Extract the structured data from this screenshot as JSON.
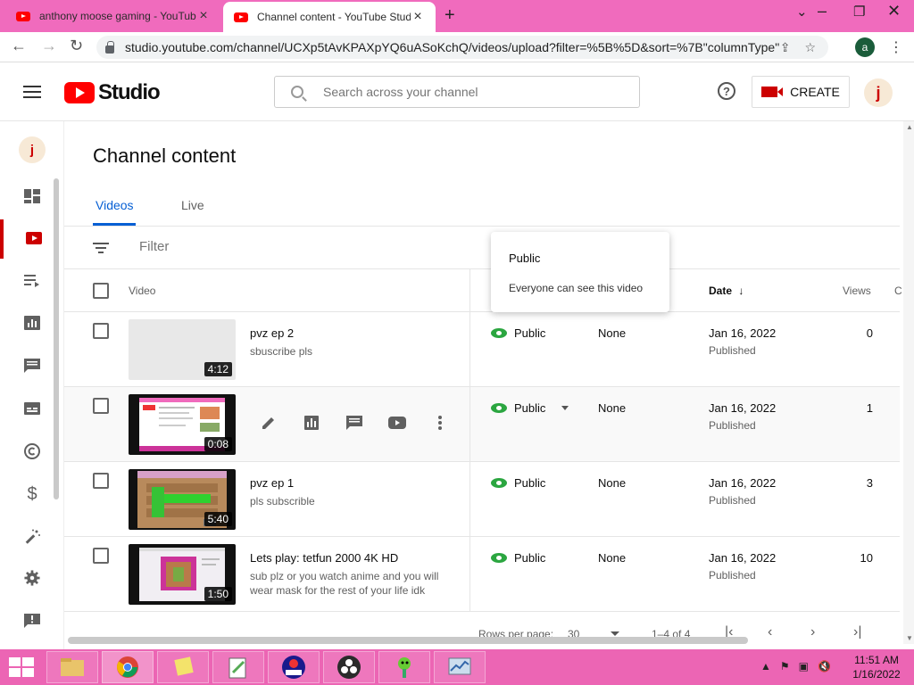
{
  "browser": {
    "tabs": [
      {
        "title": "anthony moose gaming - YouTube",
        "active": false
      },
      {
        "title": "Channel content - YouTube Studio",
        "active": true
      }
    ],
    "new_tab": "+",
    "url": "studio.youtube.com/channel/UCXp5tAvKPAXpYQ6uASoKchQ/videos/upload?filter=%5B%5D&sort=%7B\"columnType\"...",
    "profile_initial": "a"
  },
  "studio": {
    "logo_text": "Studio",
    "search_placeholder": "Search across your channel",
    "create_label": "CREATE",
    "avatar_letter": "j"
  },
  "content": {
    "page_title": "Channel content",
    "tabs": [
      "Videos",
      "Live"
    ],
    "filter_placeholder": "Filter",
    "columns": {
      "video": "Video",
      "date": "Date",
      "views": "Views",
      "comments_cut": "C"
    },
    "rows": [
      {
        "title": "pvz ep 2",
        "description": "sbuscribe pls",
        "duration": "4:12",
        "visibility": "Public",
        "restrictions": "None",
        "date": "Jan 16, 2022",
        "status": "Published",
        "views": "0"
      },
      {
        "title": "",
        "description": "",
        "duration": "0:08",
        "visibility": "Public",
        "restrictions": "None",
        "date": "Jan 16, 2022",
        "status": "Published",
        "views": "1"
      },
      {
        "title": "pvz ep 1",
        "description": "pls subscrible",
        "duration": "5:40",
        "visibility": "Public",
        "restrictions": "None",
        "date": "Jan 16, 2022",
        "status": "Published",
        "views": "3"
      },
      {
        "title": "Lets play: tetfun 2000 4K HD",
        "description": "sub plz or you watch anime and you will wear mask for the rest of your life idk",
        "duration": "1:50",
        "visibility": "Public",
        "restrictions": "None",
        "date": "Jan 16, 2022",
        "status": "Published",
        "views": "10"
      }
    ],
    "tooltip": {
      "title": "Public",
      "text": "Everyone can see this video"
    },
    "footer": {
      "rows_per_page_label": "Rows per page:",
      "rows_per_page": "30",
      "range": "1–4 of 4"
    }
  },
  "taskbar": {
    "time": "11:51 AM",
    "date": "1/16/2022"
  },
  "colors": {
    "accent": "#065fd4",
    "brand_red": "#ff0000",
    "public_green": "#2ba640",
    "tab_bar": "#f06bbd",
    "taskbar": "#ec65b4"
  }
}
